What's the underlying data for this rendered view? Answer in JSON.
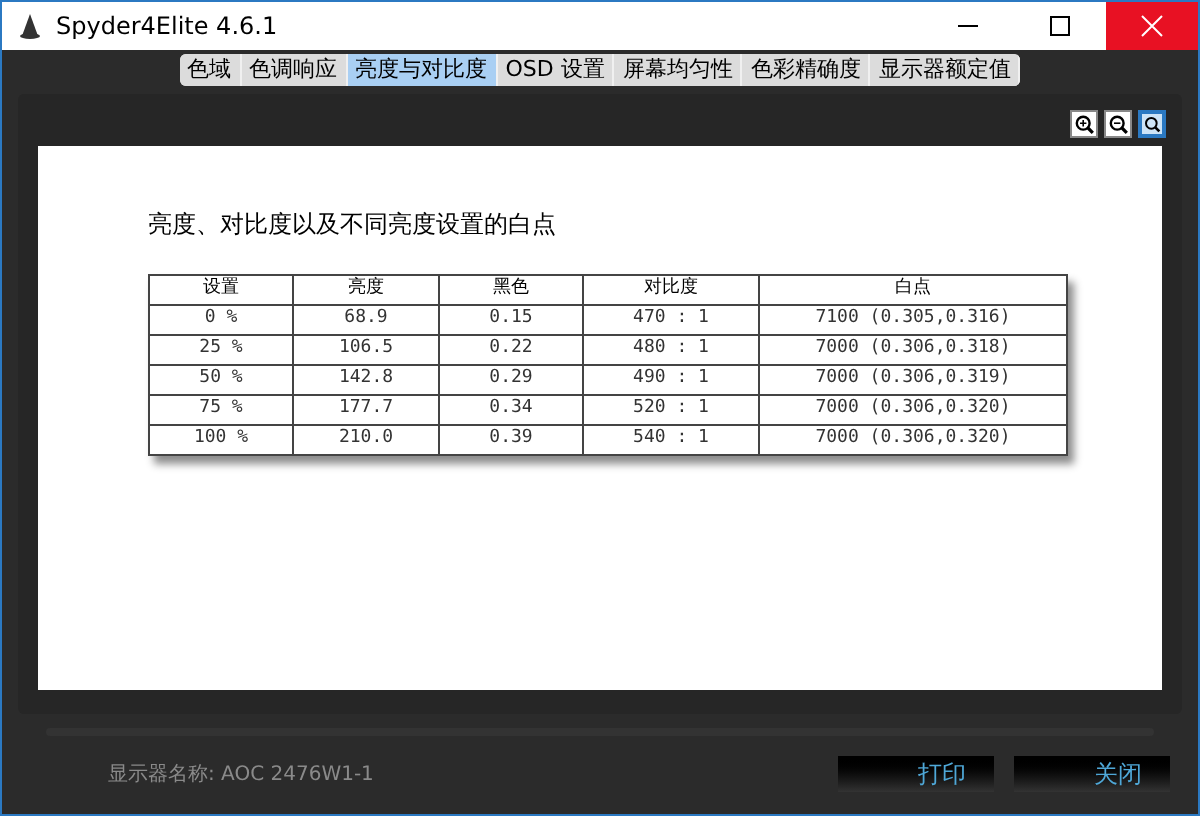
{
  "window": {
    "title": "Spyder4Elite 4.6.1"
  },
  "tabs": [
    {
      "label": "色域",
      "selected": false
    },
    {
      "label": "色调响应",
      "selected": false
    },
    {
      "label": "亮度与对比度",
      "selected": true
    },
    {
      "label": "OSD 设置",
      "selected": false
    },
    {
      "label": "屏幕均匀性",
      "selected": false
    },
    {
      "label": "色彩精确度",
      "selected": false
    },
    {
      "label": "显示器额定值",
      "selected": false
    }
  ],
  "zoom_tools": [
    {
      "kind": "zoom-in",
      "selected": false
    },
    {
      "kind": "zoom-out",
      "selected": false
    },
    {
      "kind": "fit",
      "selected": true
    }
  ],
  "report": {
    "heading": "亮度、对比度以及不同亮度设置的白点",
    "table": {
      "columns": [
        "设置",
        "亮度",
        "黑色",
        "对比度",
        "白点"
      ],
      "rows": [
        [
          "0 %",
          "68.9",
          "0.15",
          "470 : 1",
          "7100 (0.305,0.316)"
        ],
        [
          "25 %",
          "106.5",
          "0.22",
          "480 : 1",
          "7000 (0.306,0.318)"
        ],
        [
          "50 %",
          "142.8",
          "0.29",
          "490 : 1",
          "7000 (0.306,0.319)"
        ],
        [
          "75 %",
          "177.7",
          "0.34",
          "520 : 1",
          "7000 (0.306,0.320)"
        ],
        [
          "100 %",
          "210.0",
          "0.39",
          "540 : 1",
          "7000 (0.306,0.320)"
        ]
      ]
    }
  },
  "status": {
    "display_name": "显示器名称: AOC 2476W1-1"
  },
  "buttons": [
    "打印",
    "关闭"
  ]
}
